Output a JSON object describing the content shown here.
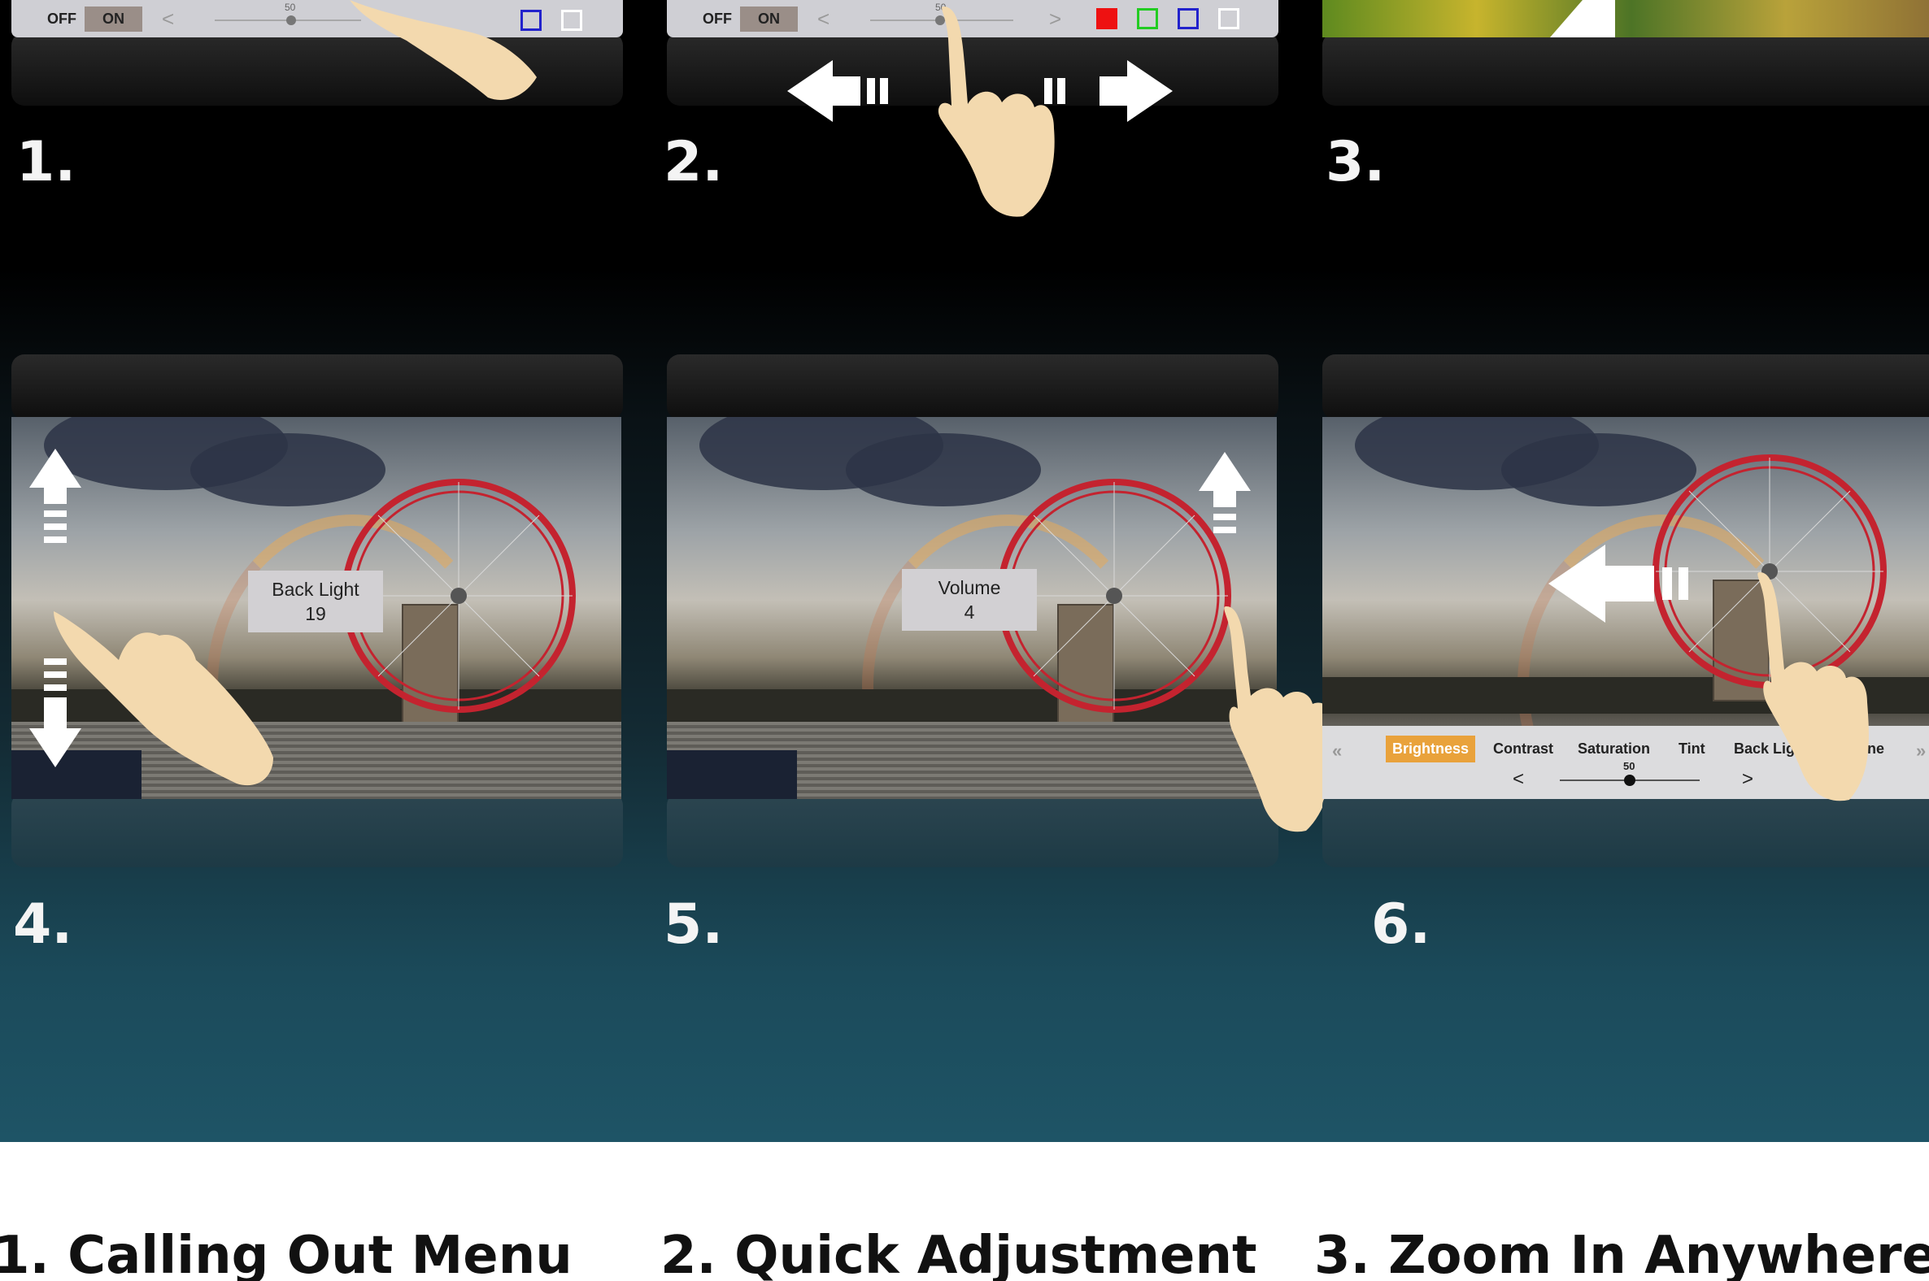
{
  "steps": [
    {
      "number": "1."
    },
    {
      "number": "2."
    },
    {
      "number": "3."
    },
    {
      "number": "4."
    },
    {
      "number": "5."
    },
    {
      "number": "6."
    }
  ],
  "toolbar": {
    "off_label": "OFF",
    "on_label": "ON",
    "prev_symbol": "<",
    "next_symbol": ">",
    "slider_value": "50"
  },
  "popup_backlight": {
    "label": "Back Light",
    "value": "19"
  },
  "popup_volume": {
    "label": "Volume",
    "value": "4"
  },
  "osd_menu": {
    "prev_page": "«",
    "next_page": "»",
    "items": [
      "Brightness",
      "Contrast",
      "Saturation",
      "Tint",
      "Back Lig",
      "ne"
    ],
    "active": "Brightness",
    "prev_symbol": "<",
    "next_symbol": ">",
    "slider_value": "50",
    "slider_fraction": 0.5
  },
  "captions": [
    "1. Calling Out Menu",
    "2. Quick Adjustment",
    "3. Zoom In Anywhere"
  ],
  "colors": {
    "accent_orange": "#e9a23b",
    "swatch_red": "#ee1111",
    "swatch_green": "#22cc22",
    "swatch_blue": "#2222cc",
    "swatch_white": "#ffffff"
  }
}
